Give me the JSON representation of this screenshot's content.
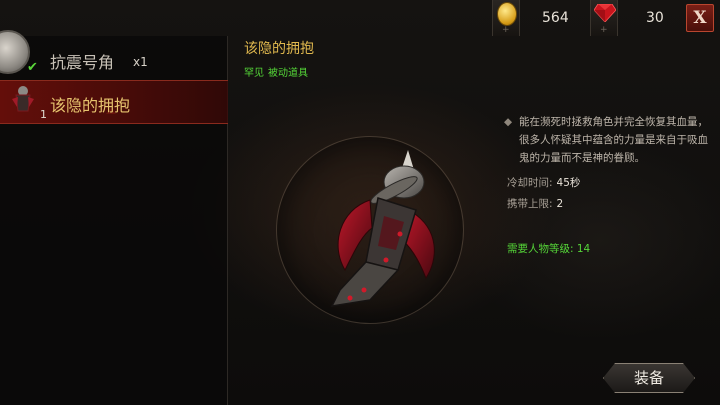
{
  "resources": {
    "gold": {
      "value": "564",
      "icon": "gold-coin-icon",
      "plus": "+"
    },
    "gems": {
      "value": "30",
      "icon": "red-gem-icon",
      "plus": "+"
    }
  },
  "close_label": "X",
  "item_list": [
    {
      "name": "抗震号角",
      "qty": "x1",
      "icon": "horn-icon",
      "equipped": true
    },
    {
      "name": "该隐的拥抱",
      "count": "1",
      "icon": "cains-embrace-icon",
      "selected": true
    }
  ],
  "detail": {
    "title": "该隐的拥抱",
    "rarity": "罕见",
    "type": "被动道具",
    "description": "能在濒死时拯救角色并完全恢复其血量，很多人怀疑其中蕴含的力量是来自于吸血鬼的力量而不是神的眷顾。",
    "cooldown_label": "冷却时间:",
    "cooldown_value": "45秒",
    "capacity_label": "携带上限:",
    "capacity_value": "2",
    "requirement": "需要人物等级: 14"
  },
  "equip_label": "装备",
  "colors": {
    "title_gold": "#e0b84e",
    "rarity_green": "#55d638",
    "selected_red": "#6e0f0a"
  }
}
